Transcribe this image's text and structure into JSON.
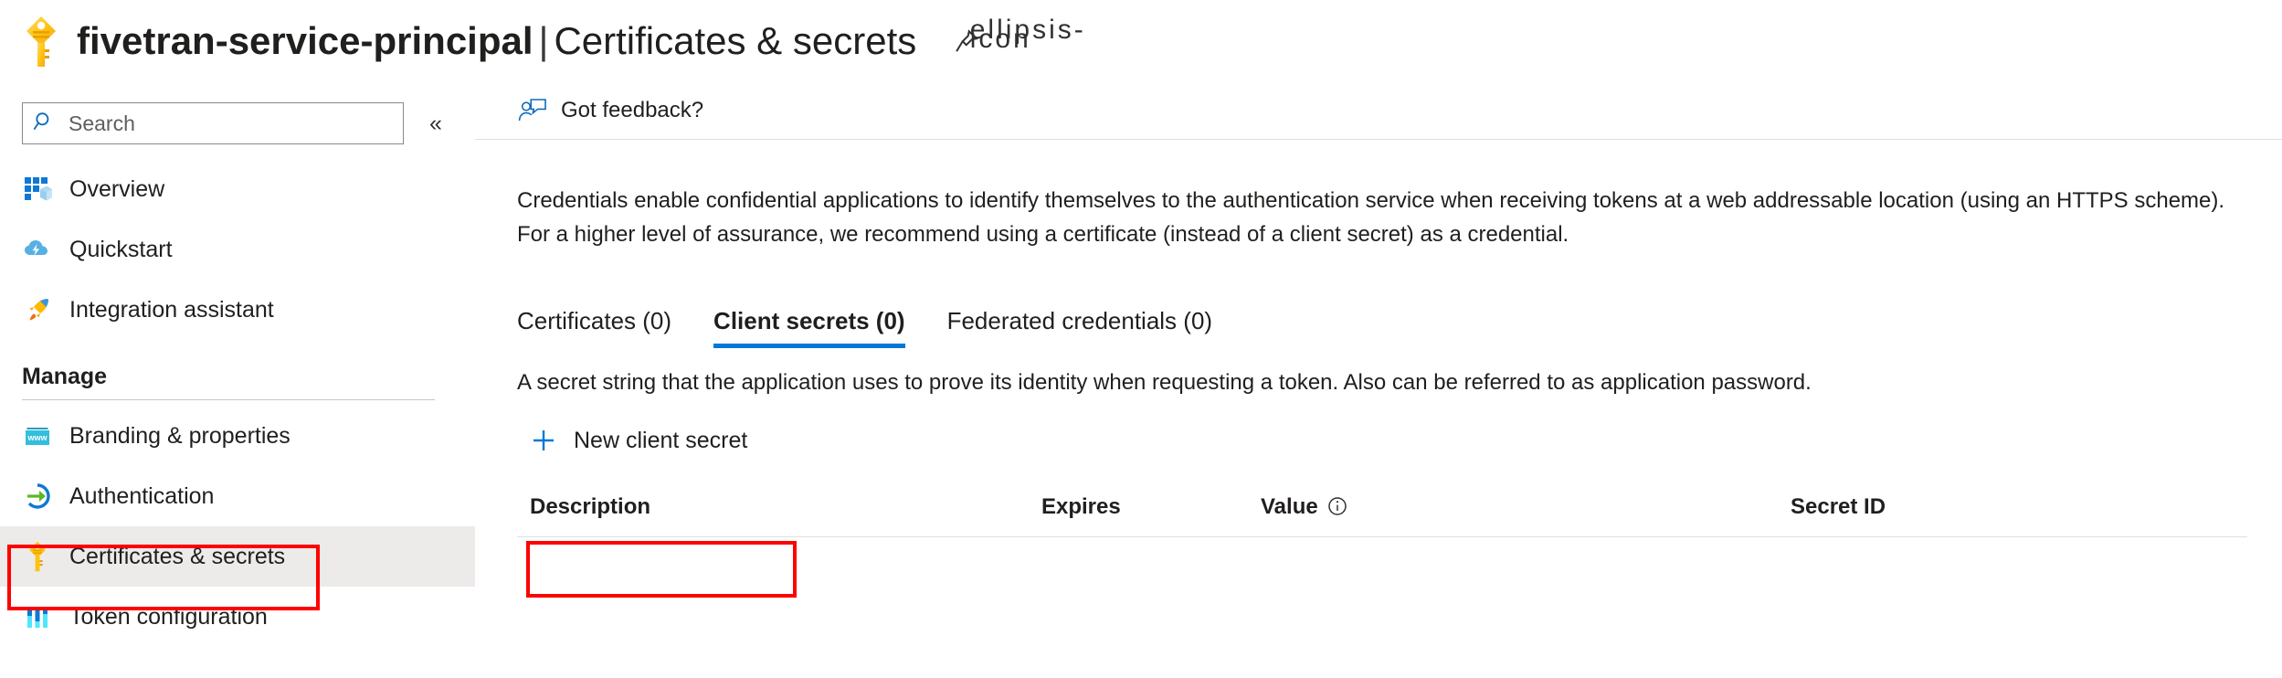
{
  "header": {
    "icon": "key-icon",
    "app_name": "fivetran-service-principal",
    "separator": "|",
    "section": "Certificates & secrets",
    "pin_icon": "pin-icon",
    "more_icon": "ellipsis-icon"
  },
  "sidebar": {
    "search": {
      "placeholder": "Search",
      "value": "",
      "icon": "search-icon"
    },
    "collapse_icon": "«",
    "items": [
      {
        "label": "Overview",
        "icon": "overview-grid-icon",
        "selected": false
      },
      {
        "label": "Quickstart",
        "icon": "cloud-lightning-icon",
        "selected": false
      },
      {
        "label": "Integration assistant",
        "icon": "rocket-icon",
        "selected": false
      }
    ],
    "group_title": "Manage",
    "manage_items": [
      {
        "label": "Branding & properties",
        "icon": "browser-www-icon",
        "selected": false
      },
      {
        "label": "Authentication",
        "icon": "authentication-arrow-icon",
        "selected": false
      },
      {
        "label": "Certificates & secrets",
        "icon": "key-icon",
        "selected": true
      },
      {
        "label": "Token configuration",
        "icon": "token-bars-icon",
        "selected": false
      }
    ]
  },
  "main": {
    "command_bar": {
      "feedback_label": "Got feedback?",
      "feedback_icon": "person-feedback-icon"
    },
    "intro_text": "Credentials enable confidential applications to identify themselves to the authentication service when receiving tokens at a web addressable location (using an HTTPS scheme). For a higher level of assurance, we recommend using a certificate (instead of a client secret) as a credential.",
    "tabs": [
      {
        "label": "Certificates (0)",
        "active": false
      },
      {
        "label": "Client secrets (0)",
        "active": true
      },
      {
        "label": "Federated credentials (0)",
        "active": false
      }
    ],
    "secret_description": "A secret string that the application uses to prove its identity when requesting a token. Also can be referred to as application password.",
    "new_secret_button": {
      "label": "New client secret",
      "icon": "plus-icon"
    },
    "table": {
      "columns": [
        {
          "label": "Description"
        },
        {
          "label": "Expires"
        },
        {
          "label": "Value",
          "info_icon": "info-icon"
        },
        {
          "label": "Secret ID"
        }
      ],
      "rows": []
    }
  },
  "annotations": {
    "accent_blue": "#0078d4",
    "highlight_red": "#ff0000",
    "selected_bg": "#edebe9",
    "key_gold": "#ffc107"
  }
}
